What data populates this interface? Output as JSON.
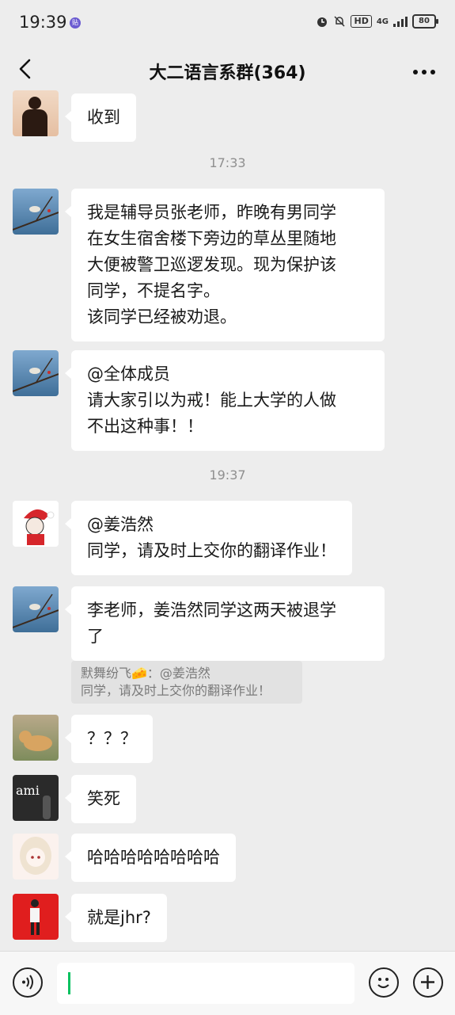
{
  "status": {
    "time": "19:39",
    "notif_badge": "贴",
    "hd": "HD",
    "net": "4G",
    "battery": "80"
  },
  "header": {
    "title": "大二语言系群(364)",
    "back_icon": "chevron-left-icon",
    "more_icon": "more-dots-icon"
  },
  "messages": [
    {
      "text": "收到"
    },
    {
      "time": "17:33"
    },
    {
      "text": "我是辅导员张老师，昨晚有男同学\n在女生宿舍楼下旁边的草丛里随地\n大便被警卫巡逻发现。现为保护该\n同学，不提名字。\n该同学已经被劝退。"
    },
    {
      "text": "@全体成员\n请大家引以为戒！能上大学的人做\n不出这种事！！"
    },
    {
      "time": "19:37"
    },
    {
      "text": "@姜浩然\n同学，请及时上交你的翻译作业！"
    },
    {
      "text": "李老师，姜浩然同学这两天被退学\n了"
    },
    {
      "quote": "默舞纷飞🧀：@姜浩然\n同学，请及时上交你的翻译作业！"
    },
    {
      "text": "？？？"
    },
    {
      "text": "笑死"
    },
    {
      "text": "哈哈哈哈哈哈哈哈"
    },
    {
      "text": "就是jhr?"
    }
  ],
  "avatars": {
    "ami_text": "ami"
  },
  "input": {
    "value": ""
  },
  "colors": {
    "accent": "#07c160",
    "background": "#ededed",
    "bubble": "#ffffff"
  }
}
